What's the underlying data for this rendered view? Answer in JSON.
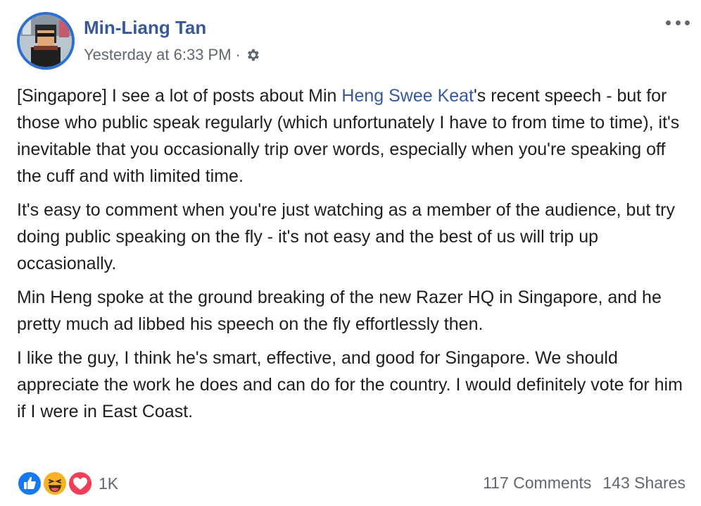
{
  "post": {
    "author": "Min-Liang Tan",
    "timestamp": "Yesterday at 6:33 PM",
    "separator": "·",
    "privacy_icon": "gear-icon",
    "more_icon": "more-options-icon",
    "paragraphs": [
      {
        "before": "[Singapore] I see a lot of posts about Min ",
        "link": "Heng Swee Keat",
        "after": "'s recent speech - but for those who public speak regularly (which unfortunately I have to from time to time), it's inevitable that you occasionally trip over words, especially when you're speaking off the cuff and with limited time."
      },
      "It's easy to comment when you're just watching as a member of the audience, but try doing public speaking on the fly - it's not easy and the best of us will trip up occasionally.",
      "Min Heng spoke at the ground breaking of the new Razer HQ in Singapore, and he pretty much ad libbed his speech on the fly effortlessly then.",
      "I like the guy, I think he's smart, effective, and good for Singapore. We should appreciate the work he does and can do for the country. I would definitely vote for him if I were in East Coast."
    ],
    "reactions": {
      "icons": [
        "like-icon",
        "haha-icon",
        "love-icon"
      ],
      "count": "1K"
    },
    "comments": "117 Comments",
    "shares": "143 Shares"
  },
  "colors": {
    "link": "#385898",
    "secondary_text": "#606770",
    "like": "#1877f2",
    "love": "#f33e58",
    "haha": "#f7b125"
  }
}
